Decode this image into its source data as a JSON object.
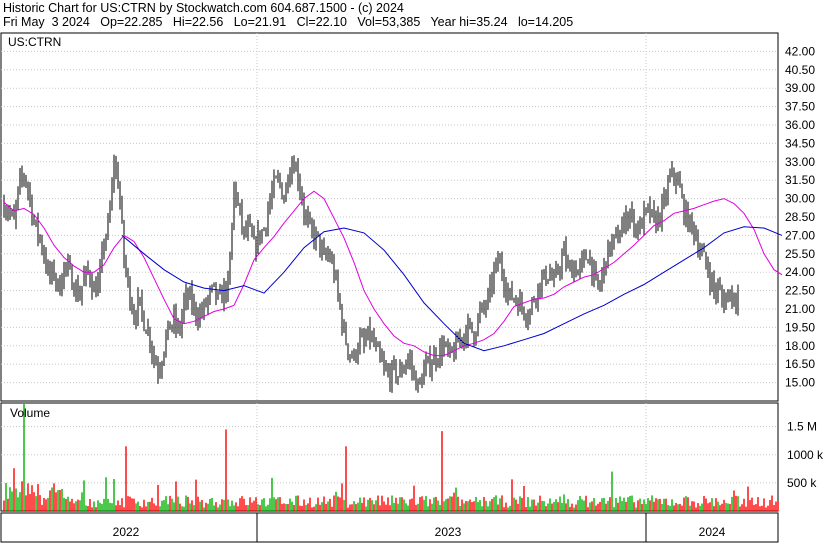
{
  "header": {
    "line1": "Historic Chart for US:CTRN by Stockwatch.com 604.687.1500 - (c) 2024",
    "line2": "Fri May  3 2024   Op=22.285   Hi=22.56   Lo=21.91   Cl=22.10   Vol=53,385   Year hi=35.24   lo=14.205"
  },
  "chart_data": [
    {
      "type": "line",
      "title": "US:CTRN",
      "y_ticks": [
        "42.00",
        "40.50",
        "39.00",
        "37.50",
        "36.00",
        "34.50",
        "33.00",
        "31.50",
        "30.00",
        "28.50",
        "27.00",
        "25.50",
        "24.00",
        "22.50",
        "21.00",
        "19.50",
        "18.00",
        "16.50",
        "15.00"
      ],
      "ylim": [
        13.5,
        43.5
      ],
      "x_labels": [
        "2022",
        "2023",
        "2024"
      ],
      "grid": true,
      "series": [
        {
          "kind": "daily price bars",
          "color": "#000000",
          "x": [
            0,
            5,
            10,
            15,
            20,
            25,
            30,
            35,
            40,
            45,
            50,
            55,
            60,
            65,
            70,
            75,
            80,
            85,
            90,
            95,
            100,
            105,
            110,
            115,
            120,
            125,
            130,
            135,
            140,
            145,
            150,
            155,
            160,
            165,
            170,
            175,
            180,
            185,
            190,
            195,
            200,
            205,
            210,
            215,
            220,
            225,
            230,
            235,
            240,
            245,
            250,
            255,
            260,
            265,
            270,
            275,
            280,
            285,
            290,
            295,
            300,
            305,
            310,
            315,
            320,
            325,
            330,
            335,
            340,
            345,
            350,
            355,
            360,
            365,
            370,
            375,
            380,
            385,
            390,
            395,
            400,
            405,
            410,
            415,
            420,
            425,
            430,
            435,
            440,
            445,
            450,
            455,
            460,
            465,
            470,
            475,
            480,
            485,
            490,
            495,
            500,
            505,
            510,
            515,
            520,
            525,
            530,
            535,
            540,
            545,
            550,
            555,
            560,
            565,
            570,
            575,
            580,
            585,
            590,
            595,
            600,
            605,
            610,
            615,
            620,
            625,
            630,
            635,
            640,
            645,
            650,
            655,
            660,
            665,
            670,
            675,
            680,
            685,
            690,
            695,
            700,
            705,
            710,
            715,
            720,
            725,
            730,
            735,
            740,
            745,
            750,
            755,
            760,
            765,
            770,
            775
          ],
          "close": [
            29.5,
            29.0,
            28.0,
            31.0,
            32.0,
            30.5,
            28.0,
            27.0,
            25.5,
            23.5,
            24.0,
            22.5,
            24.5,
            24.0,
            23.0,
            22.0,
            23.5,
            24.0,
            22.5,
            23.0,
            26.5,
            28.0,
            33.0,
            31.0,
            25.0,
            22.5,
            20.5,
            21.5,
            20.0,
            19.0,
            17.0,
            16.0,
            18.0,
            19.5,
            20.0,
            19.0,
            21.5,
            22.0,
            21.0,
            20.5,
            21.0,
            22.0,
            22.5,
            21.5,
            22.5,
            23.0,
            31.0,
            29.0,
            27.0,
            27.5,
            26.0,
            27.0,
            27.5,
            29.5,
            31.0,
            31.5,
            30.0,
            32.5,
            33.0,
            31.5,
            29.0,
            27.5,
            27.0,
            26.5,
            25.0,
            25.5,
            24.0,
            21.5,
            19.0,
            17.5,
            17.0,
            18.5,
            18.0,
            19.0,
            18.0,
            17.0,
            16.0,
            15.5,
            16.0,
            15.5,
            16.5,
            17.0,
            15.5,
            14.5,
            16.0,
            16.5,
            17.0,
            17.5,
            18.0,
            17.0,
            17.5,
            18.5,
            19.0,
            19.5,
            19.0,
            20.5,
            21.0,
            22.0,
            24.0,
            25.0,
            23.5,
            22.0,
            22.0,
            21.5,
            21.0,
            20.5,
            22.0,
            23.0,
            23.5,
            24.0,
            23.0,
            24.5,
            25.5,
            24.0,
            24.5,
            24.0,
            25.0,
            25.5,
            23.5,
            22.5,
            24.5,
            26.0,
            26.5,
            27.0,
            28.0,
            29.0,
            28.0,
            27.5,
            28.5,
            29.0,
            28.0,
            28.5,
            29.5,
            31.5,
            32.0,
            31.0,
            29.0,
            28.0,
            27.5,
            26.0,
            25.0,
            24.0,
            22.5,
            22.5,
            21.5,
            22.5,
            22.0,
            22.1
          ]
        },
        {
          "kind": "short moving average",
          "color": "#e000e0",
          "x": [
            0,
            10,
            20,
            30,
            40,
            50,
            60,
            70,
            80,
            90,
            100,
            110,
            120,
            130,
            140,
            150,
            160,
            170,
            180,
            190,
            200,
            210,
            220,
            230,
            240,
            250,
            260,
            270,
            280,
            290,
            300,
            310,
            320,
            330,
            340,
            350,
            360,
            370,
            380,
            390,
            400,
            410,
            420,
            430,
            440,
            450,
            460,
            470,
            480,
            490,
            500,
            510,
            520,
            530,
            540,
            550,
            560,
            570,
            580,
            590,
            600,
            610,
            620,
            630,
            640,
            650,
            660,
            670,
            680,
            690,
            700,
            710,
            720,
            730,
            740,
            750,
            760,
            770,
            778
          ],
          "values": [
            29.7,
            29.0,
            29.2,
            28.7,
            27.6,
            26.2,
            25.2,
            24.5,
            24.0,
            24.0,
            24.6,
            26.0,
            27.0,
            26.5,
            25.2,
            23.5,
            21.8,
            20.2,
            19.8,
            20.0,
            20.4,
            20.8,
            21.0,
            21.3,
            23.0,
            25.0,
            26.0,
            26.9,
            28.0,
            29.0,
            30.0,
            30.6,
            30.0,
            28.4,
            26.8,
            24.8,
            22.5,
            21.0,
            19.8,
            18.8,
            18.2,
            18.0,
            17.5,
            17.2,
            17.2,
            17.6,
            18.0,
            18.2,
            18.5,
            19.0,
            20.0,
            21.2,
            21.5,
            21.8,
            21.9,
            22.2,
            22.8,
            23.2,
            23.6,
            23.8,
            24.3,
            24.8,
            25.5,
            26.2,
            27.0,
            27.8,
            28.2,
            28.8,
            29.0,
            29.2,
            29.5,
            29.8,
            30.0,
            29.6,
            28.8,
            27.5,
            25.5,
            24.2,
            23.8
          ]
        },
        {
          "kind": "long moving average",
          "color": "#0000cc",
          "x": [
            118,
            140,
            160,
            180,
            200,
            220,
            240,
            260,
            280,
            300,
            320,
            340,
            360,
            380,
            400,
            420,
            440,
            460,
            480,
            500,
            520,
            540,
            560,
            580,
            600,
            620,
            640,
            660,
            680,
            700,
            720,
            740,
            760,
            778
          ],
          "values": [
            27.0,
            25.5,
            24.2,
            23.2,
            22.7,
            22.5,
            22.9,
            22.3,
            24.0,
            26.0,
            27.3,
            27.6,
            27.2,
            25.8,
            23.8,
            21.5,
            19.8,
            18.2,
            17.6,
            18.0,
            18.5,
            19.0,
            19.8,
            20.6,
            21.3,
            22.2,
            23.0,
            24.0,
            25.0,
            26.0,
            27.2,
            27.7,
            27.6,
            27.0
          ]
        }
      ]
    },
    {
      "type": "bar",
      "title": "Volume",
      "y_ticks": [
        "1.5 M",
        "1000 k",
        "500 k"
      ],
      "ylim": [
        0,
        1920000
      ],
      "up_color": "#00b000",
      "down_color": "#ff0000"
    }
  ]
}
